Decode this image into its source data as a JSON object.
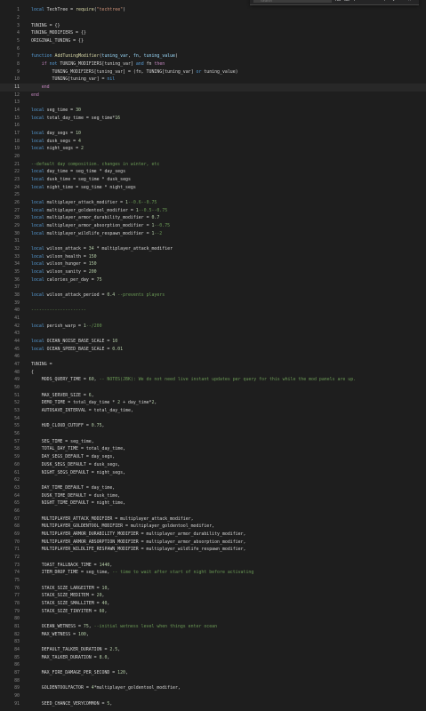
{
  "find_widget": {
    "placeholder": "Search",
    "icons": [
      "match-case-icon",
      "match-whole-word-icon",
      "regex-icon",
      "previous-match-icon",
      "next-match-icon",
      "close-icon"
    ]
  },
  "current_line": 11,
  "lines": [
    [
      [
        "kw2",
        "local"
      ],
      [
        "",
        "TechTree = "
      ],
      [
        "fn",
        "require"
      ],
      [
        "",
        "("
      ],
      [
        "str",
        "\"techtree\""
      ],
      [
        "",
        ")"
      ]
    ],
    [],
    [
      [
        "",
        "TUNING = {}"
      ]
    ],
    [
      [
        "",
        "TUNING_MODIFIERS = {}"
      ]
    ],
    [
      [
        "",
        "ORIGINAL_TUNING = {}"
      ]
    ],
    [],
    [
      [
        "kw2",
        "function"
      ],
      [
        "",
        ""
      ],
      [
        "fn",
        "AddTuningModifier"
      ],
      [
        "",
        "("
      ],
      [
        "var",
        "tuning_var"
      ],
      [
        "",
        ", "
      ],
      [
        "var",
        "fn"
      ],
      [
        "",
        ", "
      ],
      [
        "var",
        "tuning_value"
      ],
      [
        "",
        ")"
      ]
    ],
    [
      [
        "",
        "    "
      ],
      [
        "kw",
        "if"
      ],
      [
        "",
        ""
      ],
      [
        "kw2",
        "not"
      ],
      [
        "",
        "TUNING_MODIFIERS[tuning_var] "
      ],
      [
        "kw2",
        "and"
      ],
      [
        "",
        "fn "
      ],
      [
        "kw",
        "then"
      ]
    ],
    [
      [
        "",
        "        TUNING_MODIFIERS[tuning_var] = (fn, TUNING[tuning_var] "
      ],
      [
        "kw2",
        "or"
      ],
      [
        "",
        "tuning_value)"
      ]
    ],
    [
      [
        "",
        "        TUNING[tuning_var] = "
      ],
      [
        "kw2",
        "nil"
      ]
    ],
    [
      [
        "",
        "    "
      ],
      [
        "kw",
        "end"
      ]
    ],
    [
      [
        "kw",
        "end"
      ]
    ],
    [],
    [
      [
        "kw2",
        "local"
      ],
      [
        "",
        "seg_time = "
      ],
      [
        "num",
        "30"
      ]
    ],
    [
      [
        "kw2",
        "local"
      ],
      [
        "",
        "total_day_time = seg_time*"
      ],
      [
        "num",
        "16"
      ]
    ],
    [],
    [
      [
        "kw2",
        "local"
      ],
      [
        "",
        "day_segs = "
      ],
      [
        "num",
        "10"
      ]
    ],
    [
      [
        "kw2",
        "local"
      ],
      [
        "",
        "dusk_segs = "
      ],
      [
        "num",
        "4"
      ]
    ],
    [
      [
        "kw2",
        "local"
      ],
      [
        "",
        "night_segs = "
      ],
      [
        "num",
        "2"
      ]
    ],
    [],
    [
      [
        "cm",
        "--default day composition. changes in winter, etc"
      ]
    ],
    [
      [
        "kw2",
        "local"
      ],
      [
        "",
        "day_time = seg_time * day_segs"
      ]
    ],
    [
      [
        "kw2",
        "local"
      ],
      [
        "",
        "dusk_time = seg_time * dusk_segs"
      ]
    ],
    [
      [
        "kw2",
        "local"
      ],
      [
        "",
        "night_time = seg_time * night_segs"
      ]
    ],
    [],
    [
      [
        "kw2",
        "local"
      ],
      [
        "",
        "multiplayer_attack_modifier = "
      ],
      [
        "num",
        "1"
      ],
      [
        "cm",
        "--0.6--0.75"
      ]
    ],
    [
      [
        "kw2",
        "local"
      ],
      [
        "",
        "multiplayer_goldentool_modifier = "
      ],
      [
        "num",
        "1"
      ],
      [
        "cm",
        "--0.5--0.75"
      ]
    ],
    [
      [
        "kw2",
        "local"
      ],
      [
        "",
        "multiplayer_armor_durability_modifier = "
      ],
      [
        "num",
        "0.7"
      ]
    ],
    [
      [
        "kw2",
        "local"
      ],
      [
        "",
        "multiplayer_armor_absorption_modifier = "
      ],
      [
        "num",
        "1"
      ],
      [
        "cm",
        "--0.75"
      ]
    ],
    [
      [
        "kw2",
        "local"
      ],
      [
        "",
        "multiplayer_wildlife_respawn_modifier = "
      ],
      [
        "num",
        "1"
      ],
      [
        "cm",
        "--2"
      ]
    ],
    [],
    [
      [
        "kw2",
        "local"
      ],
      [
        "",
        "wilson_attack = "
      ],
      [
        "num",
        "34"
      ],
      [
        "",
        ""
      ],
      [
        "",
        "* multiplayer_attack_modifier"
      ]
    ],
    [
      [
        "kw2",
        "local"
      ],
      [
        "",
        "wilson_health = "
      ],
      [
        "num",
        "150"
      ]
    ],
    [
      [
        "kw2",
        "local"
      ],
      [
        "",
        "wilson_hunger = "
      ],
      [
        "num",
        "150"
      ]
    ],
    [
      [
        "kw2",
        "local"
      ],
      [
        "",
        "wilson_sanity = "
      ],
      [
        "num",
        "200"
      ]
    ],
    [
      [
        "kw2",
        "local"
      ],
      [
        "",
        "calories_per_day = "
      ],
      [
        "num",
        "75"
      ]
    ],
    [],
    [
      [
        "kw2",
        "local"
      ],
      [
        "",
        "wilson_attack_period = "
      ],
      [
        "num",
        "0.4"
      ],
      [
        "",
        ""
      ],
      [
        "cm",
        "--prevents players"
      ]
    ],
    [],
    [
      [
        "cm",
        "---------------------"
      ]
    ],
    [],
    [
      [
        "kw2",
        "local"
      ],
      [
        "",
        "perish_warp = "
      ],
      [
        "num",
        "1"
      ],
      [
        "cm",
        "--/200"
      ]
    ],
    [],
    [
      [
        "kw2",
        "local"
      ],
      [
        "",
        "OCEAN_NOISE_BASE_SCALE = "
      ],
      [
        "num",
        "10"
      ]
    ],
    [
      [
        "kw2",
        "local"
      ],
      [
        "",
        "OCEAN_SPEED_BASE_SCALE = "
      ],
      [
        "num",
        "0.01"
      ]
    ],
    [],
    [
      [
        "",
        "TUNING ="
      ]
    ],
    [
      [
        "",
        "{"
      ]
    ],
    [
      [
        "",
        "    MODS_QUERY_TIME = "
      ],
      [
        "num",
        "60"
      ],
      [
        "",
        ", "
      ],
      [
        "cm",
        "-- NOTES(JBK): We do not need live instant updates per query for this while the mod panels are up."
      ]
    ],
    [],
    [
      [
        "",
        "    MAX_SERVER_SIZE = "
      ],
      [
        "num",
        "6"
      ],
      [
        "",
        ","
      ]
    ],
    [
      [
        "",
        "    DEMO_TIME = total_day_time * "
      ],
      [
        "num",
        "2"
      ],
      [
        "",
        ""
      ],
      [
        "",
        "+ day_time*"
      ],
      [
        "num",
        "2"
      ],
      [
        "",
        ","
      ]
    ],
    [
      [
        "",
        "    AUTOSAVE_INTERVAL = total_day_time,"
      ]
    ],
    [],
    [
      [
        "",
        "    HUD_CLOUD_CUTOFF = "
      ],
      [
        "num",
        "0.75"
      ],
      [
        "",
        ","
      ]
    ],
    [],
    [
      [
        "",
        "    SEG_TIME = seg_time,"
      ]
    ],
    [
      [
        "",
        "    TOTAL_DAY_TIME = total_day_time,"
      ]
    ],
    [
      [
        "",
        "    DAY_SEGS_DEFAULT = day_segs,"
      ]
    ],
    [
      [
        "",
        "    DUSK_SEGS_DEFAULT = dusk_segs,"
      ]
    ],
    [
      [
        "",
        "    NIGHT_SEGS_DEFAULT = night_segs,"
      ]
    ],
    [],
    [
      [
        "",
        "    DAY_TIME_DEFAULT = day_time,"
      ]
    ],
    [
      [
        "",
        "    DUSK_TIME_DEFAULT = dusk_time,"
      ]
    ],
    [
      [
        "",
        "    NIGHT_TIME_DEFAULT = night_time,"
      ]
    ],
    [],
    [
      [
        "",
        "    MULTIPLAYER_ATTACK_MODIFIER = multiplayer_attack_modifier,"
      ]
    ],
    [
      [
        "",
        "    MULTIPLAYER_GOLDENTOOL_MODIFIER = multiplayer_goldentool_modifier,"
      ]
    ],
    [
      [
        "",
        "    MULTIPLAYER_ARMOR_DURABILITY_MODIFIER = multiplayer_armor_durability_modifier,"
      ]
    ],
    [
      [
        "",
        "    MULTIPLAYER_ARMOR_ABSORPTION_MODIFIER = multiplayer_armor_absorption_modifier,"
      ]
    ],
    [
      [
        "",
        "    MULTIPLAYER_WILDLIFE_RESPAWN_MODIFIER = multiplayer_wildlife_respawn_modifier,"
      ]
    ],
    [],
    [
      [
        "",
        "    TOAST_FALLBACK_TIME = "
      ],
      [
        "num",
        "1440"
      ],
      [
        "",
        ","
      ]
    ],
    [
      [
        "",
        "    ITEM_DROP_TIME = seg_time, "
      ],
      [
        "cm",
        "-- time to wait after start of night before activating"
      ]
    ],
    [],
    [
      [
        "",
        "    STACK_SIZE_LARGEITEM = "
      ],
      [
        "num",
        "10"
      ],
      [
        "",
        ","
      ]
    ],
    [
      [
        "",
        "    STACK_SIZE_MEDITEM = "
      ],
      [
        "num",
        "20"
      ],
      [
        "",
        ","
      ]
    ],
    [
      [
        "",
        "    STACK_SIZE_SMALLITEM = "
      ],
      [
        "num",
        "40"
      ],
      [
        "",
        ","
      ]
    ],
    [
      [
        "",
        "    STACK_SIZE_TINYITEM = "
      ],
      [
        "num",
        "60"
      ],
      [
        "",
        ","
      ]
    ],
    [],
    [
      [
        "",
        "    OCEAN_WETNESS = "
      ],
      [
        "num",
        "75"
      ],
      [
        "",
        ", "
      ],
      [
        "cm",
        "--initial wetness level when things enter ocean"
      ]
    ],
    [
      [
        "",
        "    MAX_WETNESS = "
      ],
      [
        "num",
        "100"
      ],
      [
        "",
        ","
      ]
    ],
    [],
    [
      [
        "",
        "    DEFAULT_TALKER_DURATION = "
      ],
      [
        "num",
        "2.5"
      ],
      [
        "",
        ","
      ]
    ],
    [
      [
        "",
        "    MAX_TALKER_DURATION = "
      ],
      [
        "num",
        "8.0"
      ],
      [
        "",
        ","
      ]
    ],
    [],
    [
      [
        "",
        "    MAX_FIRE_DAMAGE_PER_SECOND = "
      ],
      [
        "num",
        "120"
      ],
      [
        "",
        ","
      ]
    ],
    [],
    [
      [
        "",
        "    GOLDENTOOLFACTOR = "
      ],
      [
        "num",
        "4"
      ],
      [
        "",
        "*multiplayer_goldentool_modifier,"
      ]
    ],
    [],
    [
      [
        "",
        "    SEED_CHANCE_VERYCOMMON = "
      ],
      [
        "num",
        "5"
      ],
      [
        "",
        ","
      ]
    ]
  ]
}
